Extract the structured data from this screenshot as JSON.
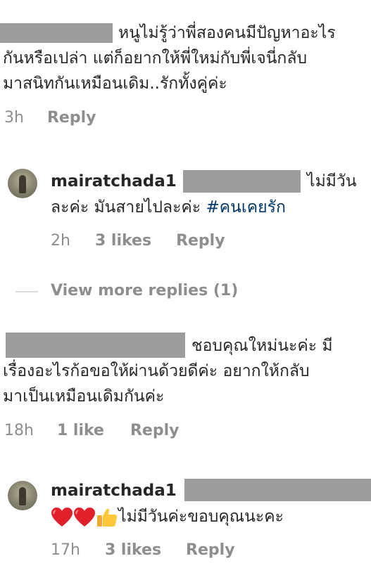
{
  "comments": [
    {
      "line1": "หนูไม่รู้ว่าพี่สองคนมีปัญหาอะไร",
      "line2": "กันหรือเปล่า แต่ก็อยากให้พี่ใหม่กับพี่เจนี่กลับ",
      "line3": "มาสนิทกันเหมือนเดิม..รักทั้งคู่ค่ะ",
      "time": "3h",
      "reply_label": "Reply"
    },
    {
      "username": "mairatchada1",
      "line1_end": "ไม่มีวัน",
      "line2_text": "ละค่ะ มันสายไปละค่ะ ",
      "hashtag": "#คนเคยรัก",
      "time": "2h",
      "likes": "3 likes",
      "reply_label": "Reply"
    },
    {
      "view_more": "View more replies (1)"
    },
    {
      "line1_end": "ชอบคุณใหม่นะค่ะ มี",
      "line2": "เรื่องอะไรก้อขอให้ผ่านด้วยดีค่ะ อยากให้กลับ",
      "line3": "มาเป็นเหมือนเดิมกันค่ะ",
      "time": "18h",
      "likes": "1 like",
      "reply_label": "Reply"
    },
    {
      "username": "mairatchada1",
      "emoji": [
        "red-heart",
        "red-heart",
        "thumbs-up"
      ],
      "text_after_emoji": "ไม่มีวันค่ะขอบคุณนะคะ",
      "time": "17h",
      "likes": "3 likes",
      "reply_label": "Reply"
    }
  ],
  "colors": {
    "text": "#262626",
    "meta": "#8e8e8e",
    "hashtag": "#00376b",
    "redaction": "#9c9c9c"
  }
}
